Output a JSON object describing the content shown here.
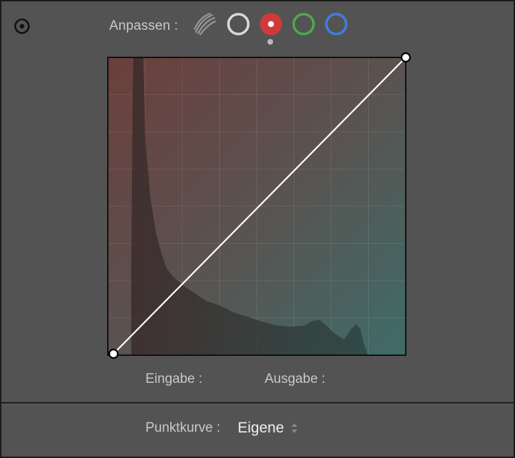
{
  "panel": {
    "adjust_label": "Anpassen :",
    "channels": [
      {
        "name": "parametric",
        "icon": "parametric-curve-icon"
      },
      {
        "name": "rgb",
        "icon": "white-ring-icon",
        "color": "#d9d9d9"
      },
      {
        "name": "red",
        "icon": "red-channel-icon",
        "color": "#d13a3a",
        "selected": true
      },
      {
        "name": "green",
        "icon": "green-ring-icon",
        "color": "#4caa4c"
      },
      {
        "name": "blue",
        "icon": "blue-ring-icon",
        "color": "#3d7fe0"
      }
    ],
    "input_label": "Eingabe :",
    "output_label": "Ausgabe :",
    "point_curve_label": "Punktkurve :",
    "point_curve_value": "Eigene"
  },
  "curve": {
    "points": [
      [
        0,
        0
      ],
      [
        1,
        1
      ]
    ],
    "grid_divisions": 8
  },
  "colors": {
    "panel_bg": "#535353",
    "curve_line": "#ffffff",
    "handle_fill": "#ffffff",
    "red_tint": "#6b3f3c",
    "cyan_tint": "#3f6c68"
  }
}
